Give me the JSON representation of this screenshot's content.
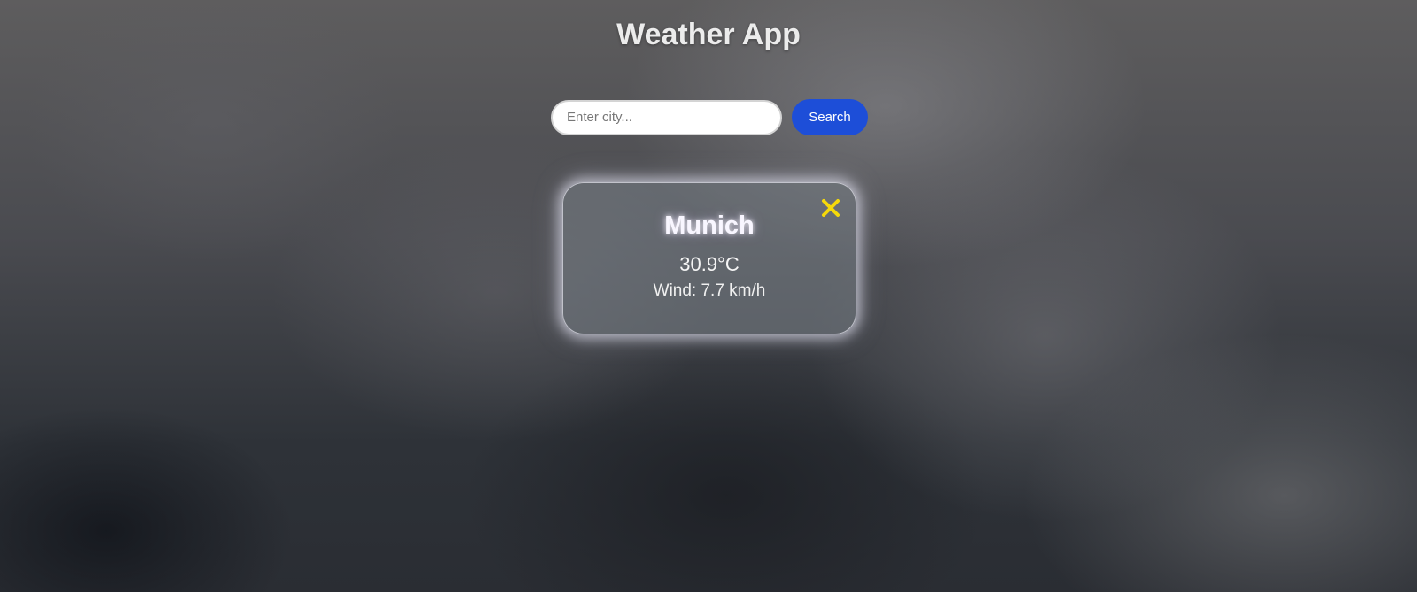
{
  "app": {
    "title": "Weather App"
  },
  "search": {
    "placeholder": "Enter city...",
    "value": "",
    "button_label": "Search"
  },
  "card": {
    "city": "Munich",
    "temperature": "30.9°C",
    "wind": "Wind: 7.7 km/h",
    "close_icon": "close-icon",
    "close_color": "#f5d90a"
  },
  "colors": {
    "accent": "#1d4ed8",
    "close": "#f5d90a"
  }
}
